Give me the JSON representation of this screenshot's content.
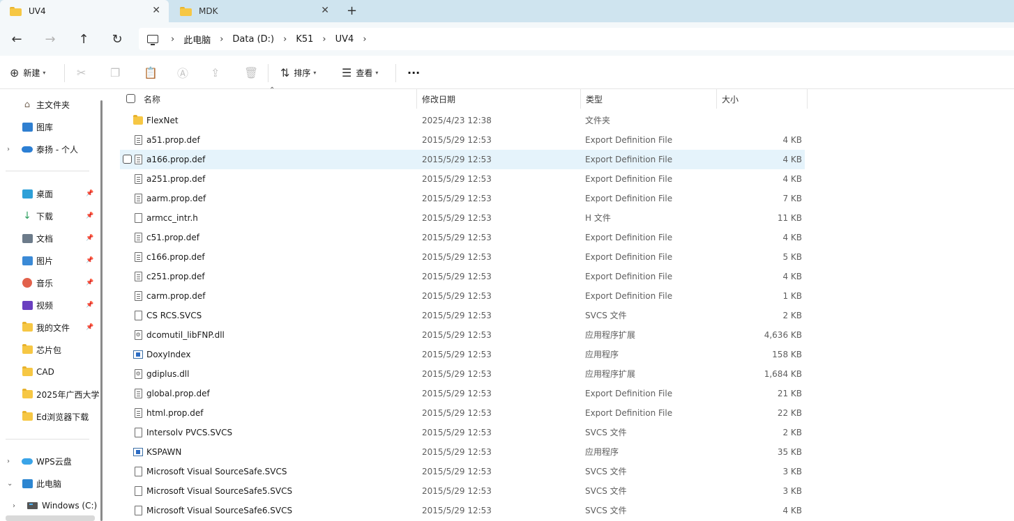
{
  "tabs": [
    {
      "label": "UV4",
      "active": true
    },
    {
      "label": "MDK",
      "active": false
    }
  ],
  "breadcrumb": [
    "此电脑",
    "Data (D:)",
    "K51",
    "UV4"
  ],
  "toolbar": {
    "new_label": "新建",
    "sort_label": "排序",
    "view_label": "查看"
  },
  "sidebar": {
    "pinned_top": [
      {
        "label": "主文件夹",
        "icon": "home-icon"
      },
      {
        "label": "图库",
        "icon": "gallery-icon"
      },
      {
        "label": "泰扬 - 个人",
        "icon": "onedrive-cloud-icon"
      }
    ],
    "quick_access": [
      {
        "label": "桌面",
        "icon": "desktop-icon",
        "pinned": true
      },
      {
        "label": "下载",
        "icon": "download-icon",
        "pinned": true
      },
      {
        "label": "文档",
        "icon": "documents-icon",
        "pinned": true
      },
      {
        "label": "图片",
        "icon": "pictures-icon",
        "pinned": true
      },
      {
        "label": "音乐",
        "icon": "music-icon",
        "pinned": true
      },
      {
        "label": "视频",
        "icon": "videos-icon",
        "pinned": true
      },
      {
        "label": "我的文件",
        "icon": "folder-icon",
        "pinned": true
      },
      {
        "label": "芯片包",
        "icon": "folder-icon",
        "pinned": false
      },
      {
        "label": "CAD",
        "icon": "folder-icon",
        "pinned": false
      },
      {
        "label": "2025年广西大学",
        "icon": "folder-icon",
        "pinned": false
      },
      {
        "label": "Ed浏览器下载",
        "icon": "folder-icon",
        "pinned": false
      }
    ],
    "locations": [
      {
        "label": "WPS云盘",
        "icon": "wps-cloud-icon"
      },
      {
        "label": "此电脑",
        "icon": "this-pc-icon"
      },
      {
        "label": "Windows (C:)",
        "icon": "drive-icon"
      }
    ]
  },
  "columns": {
    "name": "名称",
    "date": "修改日期",
    "type": "类型",
    "size": "大小"
  },
  "files": [
    {
      "name": "FlexNet",
      "date": "2025/4/23 12:38",
      "type": "文件夹",
      "size": "",
      "icon": "folder"
    },
    {
      "name": "a51.prop.def",
      "date": "2015/5/29 12:53",
      "type": "Export Definition File",
      "size": "4 KB",
      "icon": "lined"
    },
    {
      "name": "a166.prop.def",
      "date": "2015/5/29 12:53",
      "type": "Export Definition File",
      "size": "4 KB",
      "icon": "lined",
      "selected": true
    },
    {
      "name": "a251.prop.def",
      "date": "2015/5/29 12:53",
      "type": "Export Definition File",
      "size": "4 KB",
      "icon": "lined"
    },
    {
      "name": "aarm.prop.def",
      "date": "2015/5/29 12:53",
      "type": "Export Definition File",
      "size": "7 KB",
      "icon": "lined"
    },
    {
      "name": "armcc_intr.h",
      "date": "2015/5/29 12:53",
      "type": "H 文件",
      "size": "11 KB",
      "icon": "blank"
    },
    {
      "name": "c51.prop.def",
      "date": "2015/5/29 12:53",
      "type": "Export Definition File",
      "size": "4 KB",
      "icon": "lined"
    },
    {
      "name": "c166.prop.def",
      "date": "2015/5/29 12:53",
      "type": "Export Definition File",
      "size": "5 KB",
      "icon": "lined"
    },
    {
      "name": "c251.prop.def",
      "date": "2015/5/29 12:53",
      "type": "Export Definition File",
      "size": "4 KB",
      "icon": "lined"
    },
    {
      "name": "carm.prop.def",
      "date": "2015/5/29 12:53",
      "type": "Export Definition File",
      "size": "1 KB",
      "icon": "lined"
    },
    {
      "name": "CS RCS.SVCS",
      "date": "2015/5/29 12:53",
      "type": "SVCS 文件",
      "size": "2 KB",
      "icon": "blank"
    },
    {
      "name": "dcomutil_libFNP.dll",
      "date": "2015/5/29 12:53",
      "type": "应用程序扩展",
      "size": "4,636 KB",
      "icon": "gear"
    },
    {
      "name": "DoxyIndex",
      "date": "2015/5/29 12:53",
      "type": "应用程序",
      "size": "158 KB",
      "icon": "exe"
    },
    {
      "name": "gdiplus.dll",
      "date": "2015/5/29 12:53",
      "type": "应用程序扩展",
      "size": "1,684 KB",
      "icon": "gear"
    },
    {
      "name": "global.prop.def",
      "date": "2015/5/29 12:53",
      "type": "Export Definition File",
      "size": "21 KB",
      "icon": "lined"
    },
    {
      "name": "html.prop.def",
      "date": "2015/5/29 12:53",
      "type": "Export Definition File",
      "size": "22 KB",
      "icon": "lined"
    },
    {
      "name": "Intersolv PVCS.SVCS",
      "date": "2015/5/29 12:53",
      "type": "SVCS 文件",
      "size": "2 KB",
      "icon": "blank"
    },
    {
      "name": "KSPAWN",
      "date": "2015/5/29 12:53",
      "type": "应用程序",
      "size": "35 KB",
      "icon": "exe"
    },
    {
      "name": "Microsoft Visual SourceSafe.SVCS",
      "date": "2015/5/29 12:53",
      "type": "SVCS 文件",
      "size": "3 KB",
      "icon": "blank"
    },
    {
      "name": "Microsoft Visual SourceSafe5.SVCS",
      "date": "2015/5/29 12:53",
      "type": "SVCS 文件",
      "size": "3 KB",
      "icon": "blank"
    },
    {
      "name": "Microsoft Visual SourceSafe6.SVCS",
      "date": "2015/5/29 12:53",
      "type": "SVCS 文件",
      "size": "4 KB",
      "icon": "blank"
    }
  ]
}
